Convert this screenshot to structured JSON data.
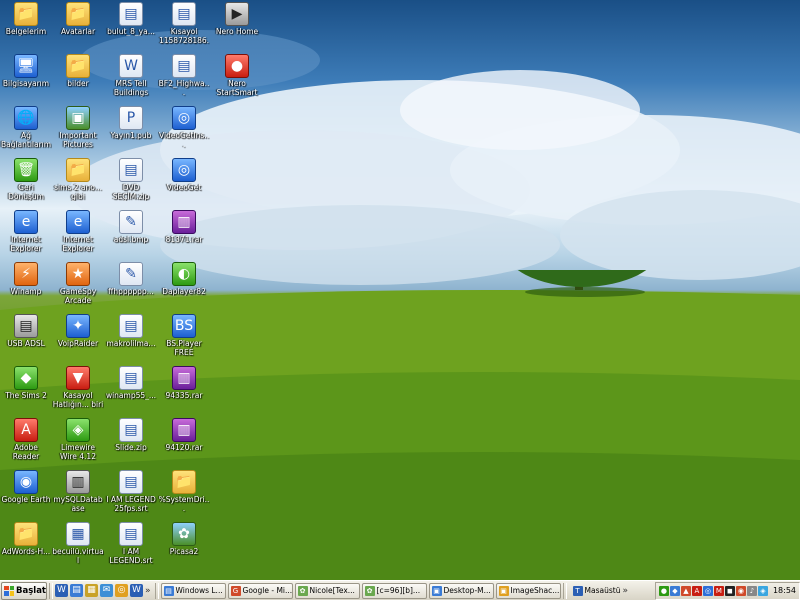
{
  "desktop_icons": [
    {
      "label": "Belgelerim",
      "glyph": "📁",
      "icon": "my-documents-icon",
      "style": "g-folder"
    },
    {
      "label": "Bilgisayarım",
      "glyph": "🖥",
      "icon": "my-computer-icon",
      "style": "g-blue"
    },
    {
      "label": "Ağ Bağlantılarım",
      "glyph": "🌐",
      "icon": "network-icon",
      "style": "g-blue"
    },
    {
      "label": "Geri Dönüşüm Kutusu",
      "glyph": "🗑",
      "icon": "recycle-bin-icon",
      "style": "g-green"
    },
    {
      "label": "Internet Explorer",
      "glyph": "e",
      "icon": "internet-explorer-icon",
      "style": "g-blue"
    },
    {
      "label": "Winamp",
      "glyph": "⚡",
      "icon": "winamp-icon",
      "style": "g-orange"
    },
    {
      "label": "USB ADSL",
      "glyph": "▤",
      "icon": "usb-adsl-icon",
      "style": "g-gray"
    },
    {
      "label": "The Sims 2",
      "glyph": "◆",
      "icon": "sims-icon",
      "style": "g-green"
    },
    {
      "label": "Adobe Reader",
      "glyph": "A",
      "icon": "adobe-reader-icon",
      "style": "g-red"
    },
    {
      "label": "Google Earth",
      "glyph": "◉",
      "icon": "google-earth-icon",
      "style": "g-blue"
    },
    {
      "label": "AdWords-H...",
      "glyph": "📁",
      "icon": "folder-icon",
      "style": "g-folder"
    },
    {
      "label": "Avatarlar",
      "glyph": "📁",
      "icon": "folder-icon",
      "style": "g-folder"
    },
    {
      "label": "bilder",
      "glyph": "📁",
      "icon": "folder-icon",
      "style": "g-folder"
    },
    {
      "label": "Important Pictures",
      "glyph": "▣",
      "icon": "picture-icon",
      "style": "g-img"
    },
    {
      "label": "sims 2 ano... gibi",
      "glyph": "📁",
      "icon": "folder-icon",
      "style": "g-folder"
    },
    {
      "label": "Internet Explorer",
      "glyph": "e",
      "icon": "internet-explorer-icon",
      "style": "g-blue"
    },
    {
      "label": "GameSpy Arcade",
      "glyph": "★",
      "icon": "gamespy-icon",
      "style": "g-orange"
    },
    {
      "label": "VoipRaider",
      "glyph": "✦",
      "icon": "voipraider-icon",
      "style": "g-blue"
    },
    {
      "label": "Kasayol Hatlığın... biri",
      "glyph": "▼",
      "icon": "shortcut-icon",
      "style": "g-red"
    },
    {
      "label": "Limewire Wire 4.12",
      "glyph": "◈",
      "icon": "limewire-icon",
      "style": "g-green"
    },
    {
      "label": "mySQLDatabase",
      "glyph": "▥",
      "icon": "application-icon",
      "style": "g-gray"
    },
    {
      "label": "becuilü.virtual",
      "glyph": "▦",
      "icon": "file-icon",
      "style": "g-doc"
    },
    {
      "label": "bulut_8_ya...",
      "glyph": "▤",
      "icon": "document-icon",
      "style": "g-doc"
    },
    {
      "label": "MRS Tell Buildings Qu...",
      "glyph": "W",
      "icon": "word-document-icon",
      "style": "g-doc"
    },
    {
      "label": "Yayın1.pub",
      "glyph": "P",
      "icon": "publisher-icon",
      "style": "g-doc"
    },
    {
      "label": "DVD SEÇİM.zip",
      "glyph": "▤",
      "icon": "zip-icon",
      "style": "g-doc"
    },
    {
      "label": "adsl.bmp",
      "glyph": "✎",
      "icon": "bitmap-icon",
      "style": "g-doc"
    },
    {
      "label": "ffhpppppp...",
      "glyph": "✎",
      "icon": "bitmap-icon",
      "style": "g-doc"
    },
    {
      "label": "makrolilma...",
      "glyph": "▤",
      "icon": "document-icon",
      "style": "g-doc"
    },
    {
      "label": "winamp55_...",
      "glyph": "▤",
      "icon": "installer-icon",
      "style": "g-doc"
    },
    {
      "label": "Slide.zip",
      "glyph": "▤",
      "icon": "zip-icon",
      "style": "g-doc"
    },
    {
      "label": "I AM LEGEND 25fps.srt",
      "glyph": "▤",
      "icon": "text-file-icon",
      "style": "g-doc"
    },
    {
      "label": "I AM LEGEND.srt",
      "glyph": "▤",
      "icon": "text-file-icon",
      "style": "g-doc"
    },
    {
      "label": "Kısayol 1158728186...",
      "glyph": "▤",
      "icon": "shortcut-icon",
      "style": "g-doc"
    },
    {
      "label": "BF2_Highwa...",
      "glyph": "▤",
      "icon": "document-icon",
      "style": "g-doc"
    },
    {
      "label": "VideoGetIns...",
      "glyph": "◎",
      "icon": "installer-icon",
      "style": "g-blue"
    },
    {
      "label": "VideoGet",
      "glyph": "◎",
      "icon": "videoget-icon",
      "style": "g-blue"
    },
    {
      "label": "81371.rar",
      "glyph": "▥",
      "icon": "rar-icon",
      "style": "g-rar"
    },
    {
      "label": "Daplayer82",
      "glyph": "◐",
      "icon": "player-icon",
      "style": "g-green"
    },
    {
      "label": "BS.Player FREE",
      "glyph": "BS",
      "icon": "bsplayer-icon",
      "style": "g-blue"
    },
    {
      "label": "94335.rar",
      "glyph": "▥",
      "icon": "rar-icon",
      "style": "g-rar"
    },
    {
      "label": "94120.rar",
      "glyph": "▥",
      "icon": "rar-icon",
      "style": "g-rar"
    },
    {
      "label": "%SystemDri...",
      "glyph": "📁",
      "icon": "folder-icon",
      "style": "g-folder"
    },
    {
      "label": "Picasa2",
      "glyph": "✿",
      "icon": "picasa-icon",
      "style": "g-img"
    },
    {
      "label": "Nero Home",
      "glyph": "▶",
      "icon": "nero-home-icon",
      "style": "g-gray"
    },
    {
      "label": "Nero StartSmart",
      "glyph": "●",
      "icon": "nero-startsmart-icon",
      "style": "g-red"
    }
  ],
  "taskbar": {
    "start_label": "Başlat",
    "quick_launch": [
      {
        "glyph": "W",
        "color": "#2b5fb4",
        "icon": "word-icon"
      },
      {
        "glyph": "▤",
        "color": "#3a7bd5",
        "icon": "document-icon"
      },
      {
        "glyph": "▦",
        "color": "#c9a227",
        "icon": "folder-icon"
      },
      {
        "glyph": "✉",
        "color": "#3d8fd6",
        "icon": "mail-icon"
      },
      {
        "glyph": "◎",
        "color": "#e0a020",
        "icon": "explorer-icon"
      },
      {
        "glyph": "W",
        "color": "#2b5fb4",
        "icon": "word-icon"
      }
    ],
    "overflow": "»",
    "tasks": [
      {
        "label": "Windows L...",
        "glyph": "▤",
        "color": "#3a7bd5"
      },
      {
        "label": "Google - Mi...",
        "glyph": "G",
        "color": "#d04a2a"
      },
      {
        "label": "Nicole[Tex...",
        "glyph": "✿",
        "color": "#6aa84f"
      },
      {
        "label": "[c=96][b]...",
        "glyph": "✿",
        "color": "#6aa84f"
      },
      {
        "label": "Desktop-M...",
        "glyph": "▣",
        "color": "#3a7bd5"
      },
      {
        "label": "ImageShac...",
        "glyph": "▣",
        "color": "#e0a020"
      }
    ],
    "toolbar_label": "Masaüstü",
    "tray": [
      {
        "glyph": "●",
        "color": "#2d9a12"
      },
      {
        "glyph": "◆",
        "color": "#3a7bd5"
      },
      {
        "glyph": "▲",
        "color": "#d04a2a"
      },
      {
        "glyph": "A",
        "color": "#c81e12"
      },
      {
        "glyph": "◎",
        "color": "#2d6fd9"
      },
      {
        "glyph": "M",
        "color": "#c81e12"
      },
      {
        "glyph": "◼",
        "color": "#222"
      },
      {
        "glyph": "◉",
        "color": "#d04a2a"
      },
      {
        "glyph": "♪",
        "color": "#888"
      },
      {
        "glyph": "◈",
        "color": "#3aa6e0"
      }
    ],
    "clock": "18:54"
  }
}
